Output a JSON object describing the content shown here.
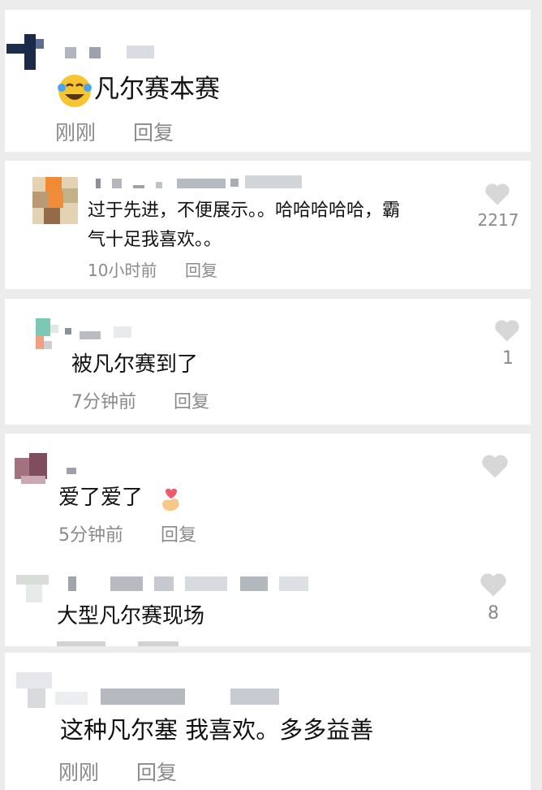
{
  "comments": [
    {
      "text": "凡尔赛本赛",
      "emoji": "laughing-tears-emoji",
      "time": "刚刚",
      "reply": "回复"
    },
    {
      "text_line1": "过于先进，不便展示。。哈哈哈哈哈，霸",
      "text_line2": "气十足我喜欢。。",
      "time": "10小时前",
      "reply": "回复",
      "likes": "2217"
    },
    {
      "text": "被凡尔赛到了",
      "time": "7分钟前",
      "reply": "回复",
      "likes": "1"
    },
    {
      "text": "爱了爱了",
      "emoji": "finger-heart-emoji",
      "time": "5分钟前",
      "reply": "回复"
    },
    {
      "text": "大型凡尔赛现场",
      "likes": "8"
    },
    {
      "text": "这种凡尔塞 我喜欢。多多益善",
      "time": "刚刚",
      "reply": "回复"
    }
  ],
  "colors": {
    "background": "#ececec",
    "card": "#ffffff",
    "text": "#111111",
    "meta": "#8a8a8a",
    "heart": "#d7d7d7"
  }
}
